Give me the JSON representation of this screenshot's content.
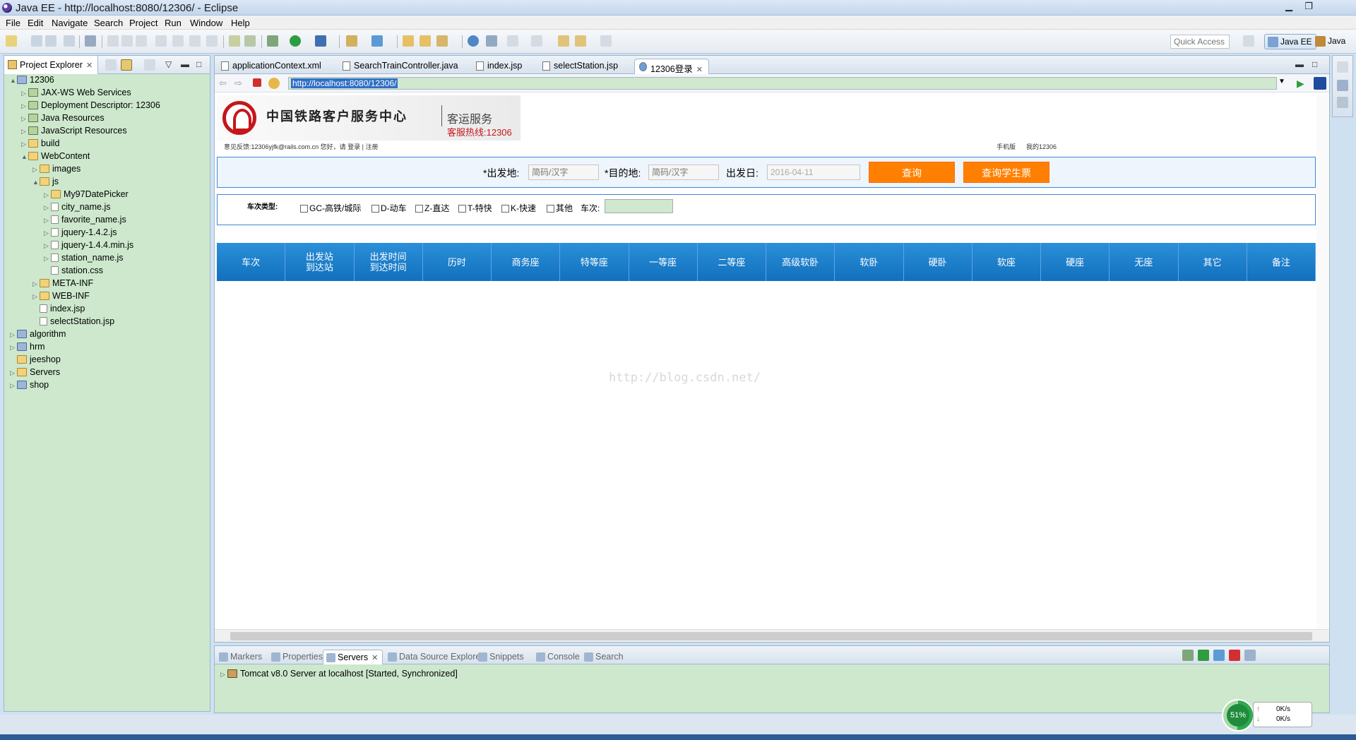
{
  "window": {
    "title": "Java EE - http://localhost:8080/12306/ - Eclipse"
  },
  "menu": [
    "File",
    "Edit",
    "Navigate",
    "Search",
    "Project",
    "Run",
    "Window",
    "Help"
  ],
  "toolbar": {
    "quick_access_placeholder": "Quick Access",
    "perspectives": [
      "Java EE",
      "Java"
    ]
  },
  "project_explorer": {
    "tab_label": "Project Explorer",
    "tree": [
      {
        "label": "12306",
        "depth": 0,
        "twisty": "▲",
        "icon": "proj"
      },
      {
        "label": "JAX-WS Web Services",
        "depth": 1,
        "twisty": "▷",
        "icon": "pkg"
      },
      {
        "label": "Deployment Descriptor: 12306",
        "depth": 1,
        "twisty": "▷",
        "icon": "pkg"
      },
      {
        "label": "Java Resources",
        "depth": 1,
        "twisty": "▷",
        "icon": "pkg"
      },
      {
        "label": "JavaScript Resources",
        "depth": 1,
        "twisty": "▷",
        "icon": "pkg"
      },
      {
        "label": "build",
        "depth": 1,
        "twisty": "▷",
        "icon": "folder"
      },
      {
        "label": "WebContent",
        "depth": 1,
        "twisty": "▲",
        "icon": "folder"
      },
      {
        "label": "images",
        "depth": 2,
        "twisty": "▷",
        "icon": "folder"
      },
      {
        "label": "js",
        "depth": 2,
        "twisty": "▲",
        "icon": "folder"
      },
      {
        "label": "My97DatePicker",
        "depth": 3,
        "twisty": "▷",
        "icon": "folder"
      },
      {
        "label": "city_name.js",
        "depth": 3,
        "twisty": "▷",
        "icon": "file"
      },
      {
        "label": "favorite_name.js",
        "depth": 3,
        "twisty": "▷",
        "icon": "file"
      },
      {
        "label": "jquery-1.4.2.js",
        "depth": 3,
        "twisty": "▷",
        "icon": "file"
      },
      {
        "label": "jquery-1.4.4.min.js",
        "depth": 3,
        "twisty": "▷",
        "icon": "file"
      },
      {
        "label": "station_name.js",
        "depth": 3,
        "twisty": "▷",
        "icon": "file"
      },
      {
        "label": "station.css",
        "depth": 3,
        "twisty": "",
        "icon": "file"
      },
      {
        "label": "META-INF",
        "depth": 2,
        "twisty": "▷",
        "icon": "folder"
      },
      {
        "label": "WEB-INF",
        "depth": 2,
        "twisty": "▷",
        "icon": "folder"
      },
      {
        "label": "index.jsp",
        "depth": 2,
        "twisty": "",
        "icon": "file"
      },
      {
        "label": "selectStation.jsp",
        "depth": 2,
        "twisty": "",
        "icon": "file"
      },
      {
        "label": "algorithm",
        "depth": 0,
        "twisty": "▷",
        "icon": "proj"
      },
      {
        "label": "hrm",
        "depth": 0,
        "twisty": "▷",
        "icon": "proj"
      },
      {
        "label": "jeeshop",
        "depth": 0,
        "twisty": "",
        "icon": "folder"
      },
      {
        "label": "Servers",
        "depth": 0,
        "twisty": "▷",
        "icon": "folder"
      },
      {
        "label": "shop",
        "depth": 0,
        "twisty": "▷",
        "icon": "proj"
      }
    ]
  },
  "editor": {
    "tabs": [
      {
        "label": "applicationContext.xml",
        "active": false
      },
      {
        "label": "SearchTrainController.java",
        "active": false
      },
      {
        "label": "index.jsp",
        "active": false
      },
      {
        "label": "selectStation.jsp",
        "active": false
      },
      {
        "label": "12306登录",
        "active": true
      }
    ],
    "url": "http://localhost:8080/12306/"
  },
  "webpage": {
    "brand": "中国铁路客户服务中心",
    "brand_sub": "客运服务",
    "hotline": "客服热线:12306",
    "topline_left": "意见反馈:12306yjfk@rails.com.cn 您好，请  登录 | 注册",
    "topline_right_1": "手机版",
    "topline_right_2": "我的12306",
    "query": {
      "from_label": "*出发地:",
      "from_placeholder": "简码/汉字",
      "to_label": "*目的地:",
      "to_placeholder": "简码/汉字",
      "date_label": "出发日:",
      "date_value": "2016-04-11",
      "search_button": "查询",
      "student_button": "查询学生票"
    },
    "filter": {
      "type_label": "车次类型:",
      "options": [
        "GC-高铁/城际",
        "D-动车",
        "Z-直达",
        "T-特快",
        "K-快速",
        "其他"
      ],
      "train_no_label": "车次:"
    },
    "result_columns": [
      "车次",
      "出发站\n到达站",
      "出发时间\n到达时间",
      "历时",
      "商务座",
      "特等座",
      "一等座",
      "二等座",
      "高级软卧",
      "软卧",
      "硬卧",
      "软座",
      "硬座",
      "无座",
      "其它",
      "备注"
    ],
    "watermark": "http://blog.csdn.net/"
  },
  "bottom_panel": {
    "tabs": [
      {
        "label": "Markers",
        "active": false
      },
      {
        "label": "Properties",
        "active": false
      },
      {
        "label": "Servers",
        "active": true
      },
      {
        "label": "Data Source Explorer",
        "active": false
      },
      {
        "label": "Snippets",
        "active": false
      },
      {
        "label": "Console",
        "active": false
      },
      {
        "label": "Search",
        "active": false
      }
    ],
    "server_entry": "Tomcat v8.0 Server at localhost  [Started, Synchronized]"
  },
  "system_widget": {
    "cpu_percent": "51%",
    "up_rate": "0K/s",
    "down_rate": "0K/s"
  },
  "colors": {
    "accent_orange": "#ff7f00",
    "header_blue": "#1a7fcf",
    "panel_green": "#cde8cd"
  }
}
